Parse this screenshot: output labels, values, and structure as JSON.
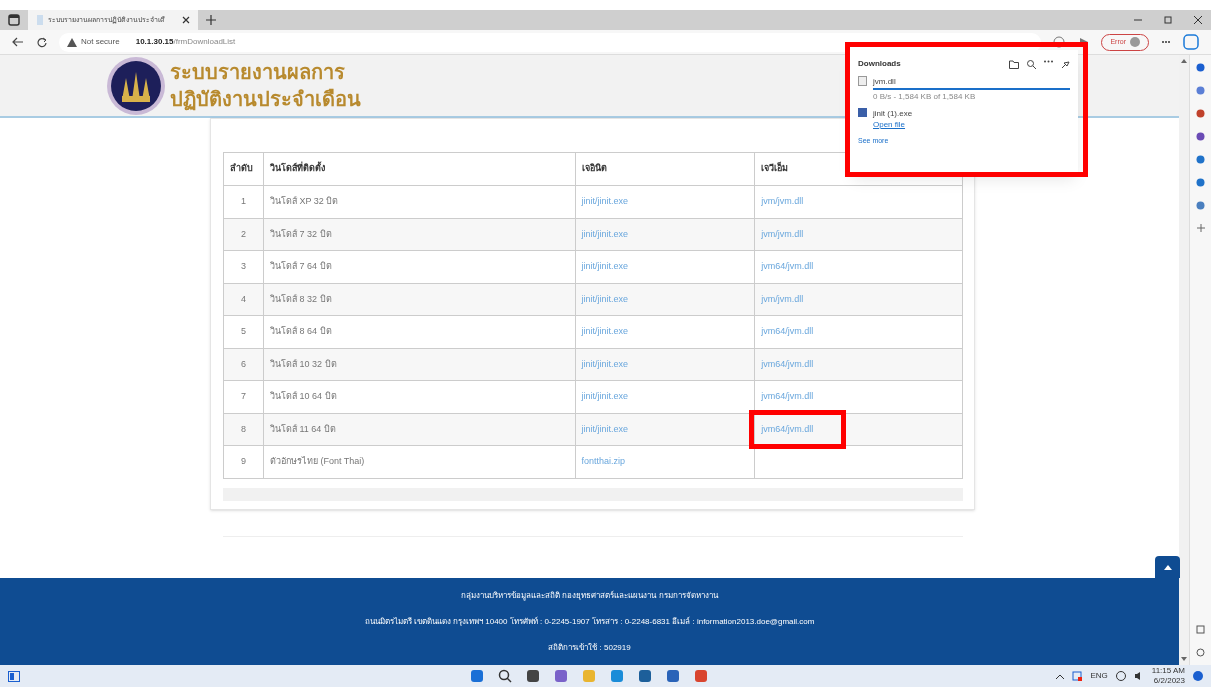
{
  "browser": {
    "tab_title": "ระบบรายงานผลการปฏิบัติงานประจำเดื",
    "address_warning": "Not secure",
    "url_host": "10.1.30.15",
    "url_path": "/frmDownloadList",
    "profile_button": "Error"
  },
  "header": {
    "title_line_1": "ระบบรายงานผลการ",
    "title_line_2": "ปฏิบัติงานประจำเดือน"
  },
  "table": {
    "columns": [
      "ลำดับ",
      "วินโดส์ที่ติดตั้ง",
      "เจอินิต",
      "เจวีเอ็ม"
    ],
    "rows": [
      {
        "index": "1",
        "system": "วินโดส์ XP 32 บิต",
        "jinit": "jinit/jinit.exe",
        "jvm": "jvm/jvm.dll",
        "highlighted": false
      },
      {
        "index": "2",
        "system": "วินโดส์ 7 32 บิต",
        "jinit": "jinit/jinit.exe",
        "jvm": "jvm/jvm.dll",
        "highlighted": false
      },
      {
        "index": "3",
        "system": "วินโดส์ 7 64 บิต",
        "jinit": "jinit/jinit.exe",
        "jvm": "jvm64/jvm.dll",
        "highlighted": false
      },
      {
        "index": "4",
        "system": "วินโดส์ 8 32 บิต",
        "jinit": "jinit/jinit.exe",
        "jvm": "jvm/jvm.dll",
        "highlighted": false
      },
      {
        "index": "5",
        "system": "วินโดส์ 8 64 บิต",
        "jinit": "jinit/jinit.exe",
        "jvm": "jvm64/jvm.dll",
        "highlighted": false
      },
      {
        "index": "6",
        "system": "วินโดส์ 10 32 บิต",
        "jinit": "jinit/jinit.exe",
        "jvm": "jvm64/jvm.dll",
        "highlighted": false
      },
      {
        "index": "7",
        "system": "วินโดส์ 10 64 บิต",
        "jinit": "jinit/jinit.exe",
        "jvm": "jvm64/jvm.dll",
        "highlighted": false
      },
      {
        "index": "8",
        "system": "วินโดส์ 11 64 บิต",
        "jinit": "jinit/jinit.exe",
        "jvm": "jvm64/jvm.dll",
        "highlighted": true
      },
      {
        "index": "9",
        "system": "ตัวอักษรไทย (Font Thai)",
        "jinit": "fontthai.zip",
        "jvm": null,
        "highlighted": false
      }
    ]
  },
  "downloads": {
    "title": "Downloads",
    "items": [
      {
        "kind": "progress",
        "name": "jvm.dll",
        "level": 1,
        "status": "0 B/s - 1,584 KB of 1,584 KB"
      },
      {
        "kind": "done",
        "name": "jinit (1).exe",
        "action": "Open file"
      }
    ],
    "see_more": "See more"
  },
  "footer": {
    "lines": [
      "กลุ่มงานบริหารข้อมูลและสถิติ กองยุทธศาสตร์และแผนงาน กรมการจัดหางาน",
      "ถนนมิตรไมตรี เขตดินแดง กรุงเทพฯ 10400 โทรศัพท์ : 0-2245-1907 โทรสาร : 0-2248-6831 อีเมล์ : information2013.doe@gmail.com",
      "สถิติการเข้าใช้ : 502919"
    ]
  },
  "taskbar": {
    "language": "ENG",
    "time": "11:15 AM",
    "date": "6/2/2023"
  }
}
